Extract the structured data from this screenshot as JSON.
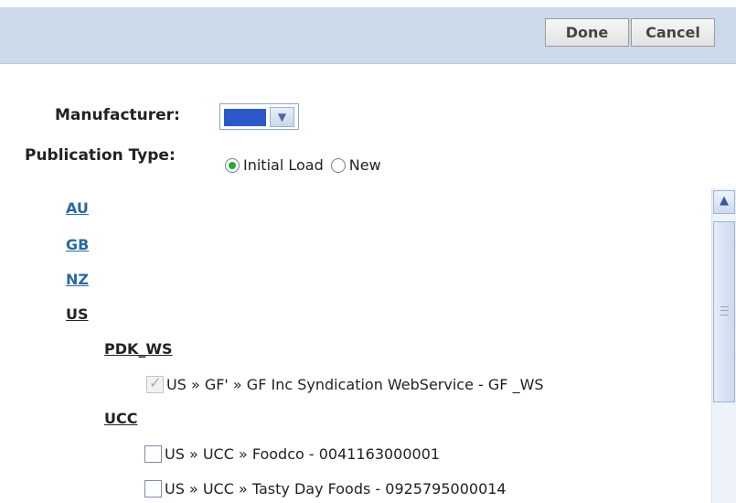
{
  "toolbar": {
    "done_label": "Done",
    "cancel_label": "Cancel"
  },
  "form": {
    "manufacturer_label": "Manufacturer:",
    "manufacturer_selected_color": "#2b59cb",
    "publication_type_label": "Publication Type:",
    "publication_options": [
      {
        "label": "Initial Load",
        "checked": true
      },
      {
        "label": "New",
        "checked": false
      }
    ]
  },
  "tree": {
    "markets": [
      "AU",
      "GB",
      "NZ",
      "US"
    ],
    "groups": [
      {
        "name": "PDK_WS",
        "items": [
          {
            "label": "US » GF' » GF Inc Syndication WebService - GF _WS",
            "checked": true,
            "disabled": true
          }
        ]
      },
      {
        "name": "UCC",
        "items": [
          {
            "label": "US » UCC » Foodco - 0041163000001",
            "checked": false,
            "disabled": false
          },
          {
            "label": "US » UCC » Tasty Day Foods - 0925795000014",
            "checked": false,
            "disabled": false
          }
        ]
      }
    ]
  },
  "colors": {
    "toolbar_bg": "#cbd9ea",
    "link_blue": "#2a6aa0",
    "radio_selected": "#2fa82f"
  }
}
